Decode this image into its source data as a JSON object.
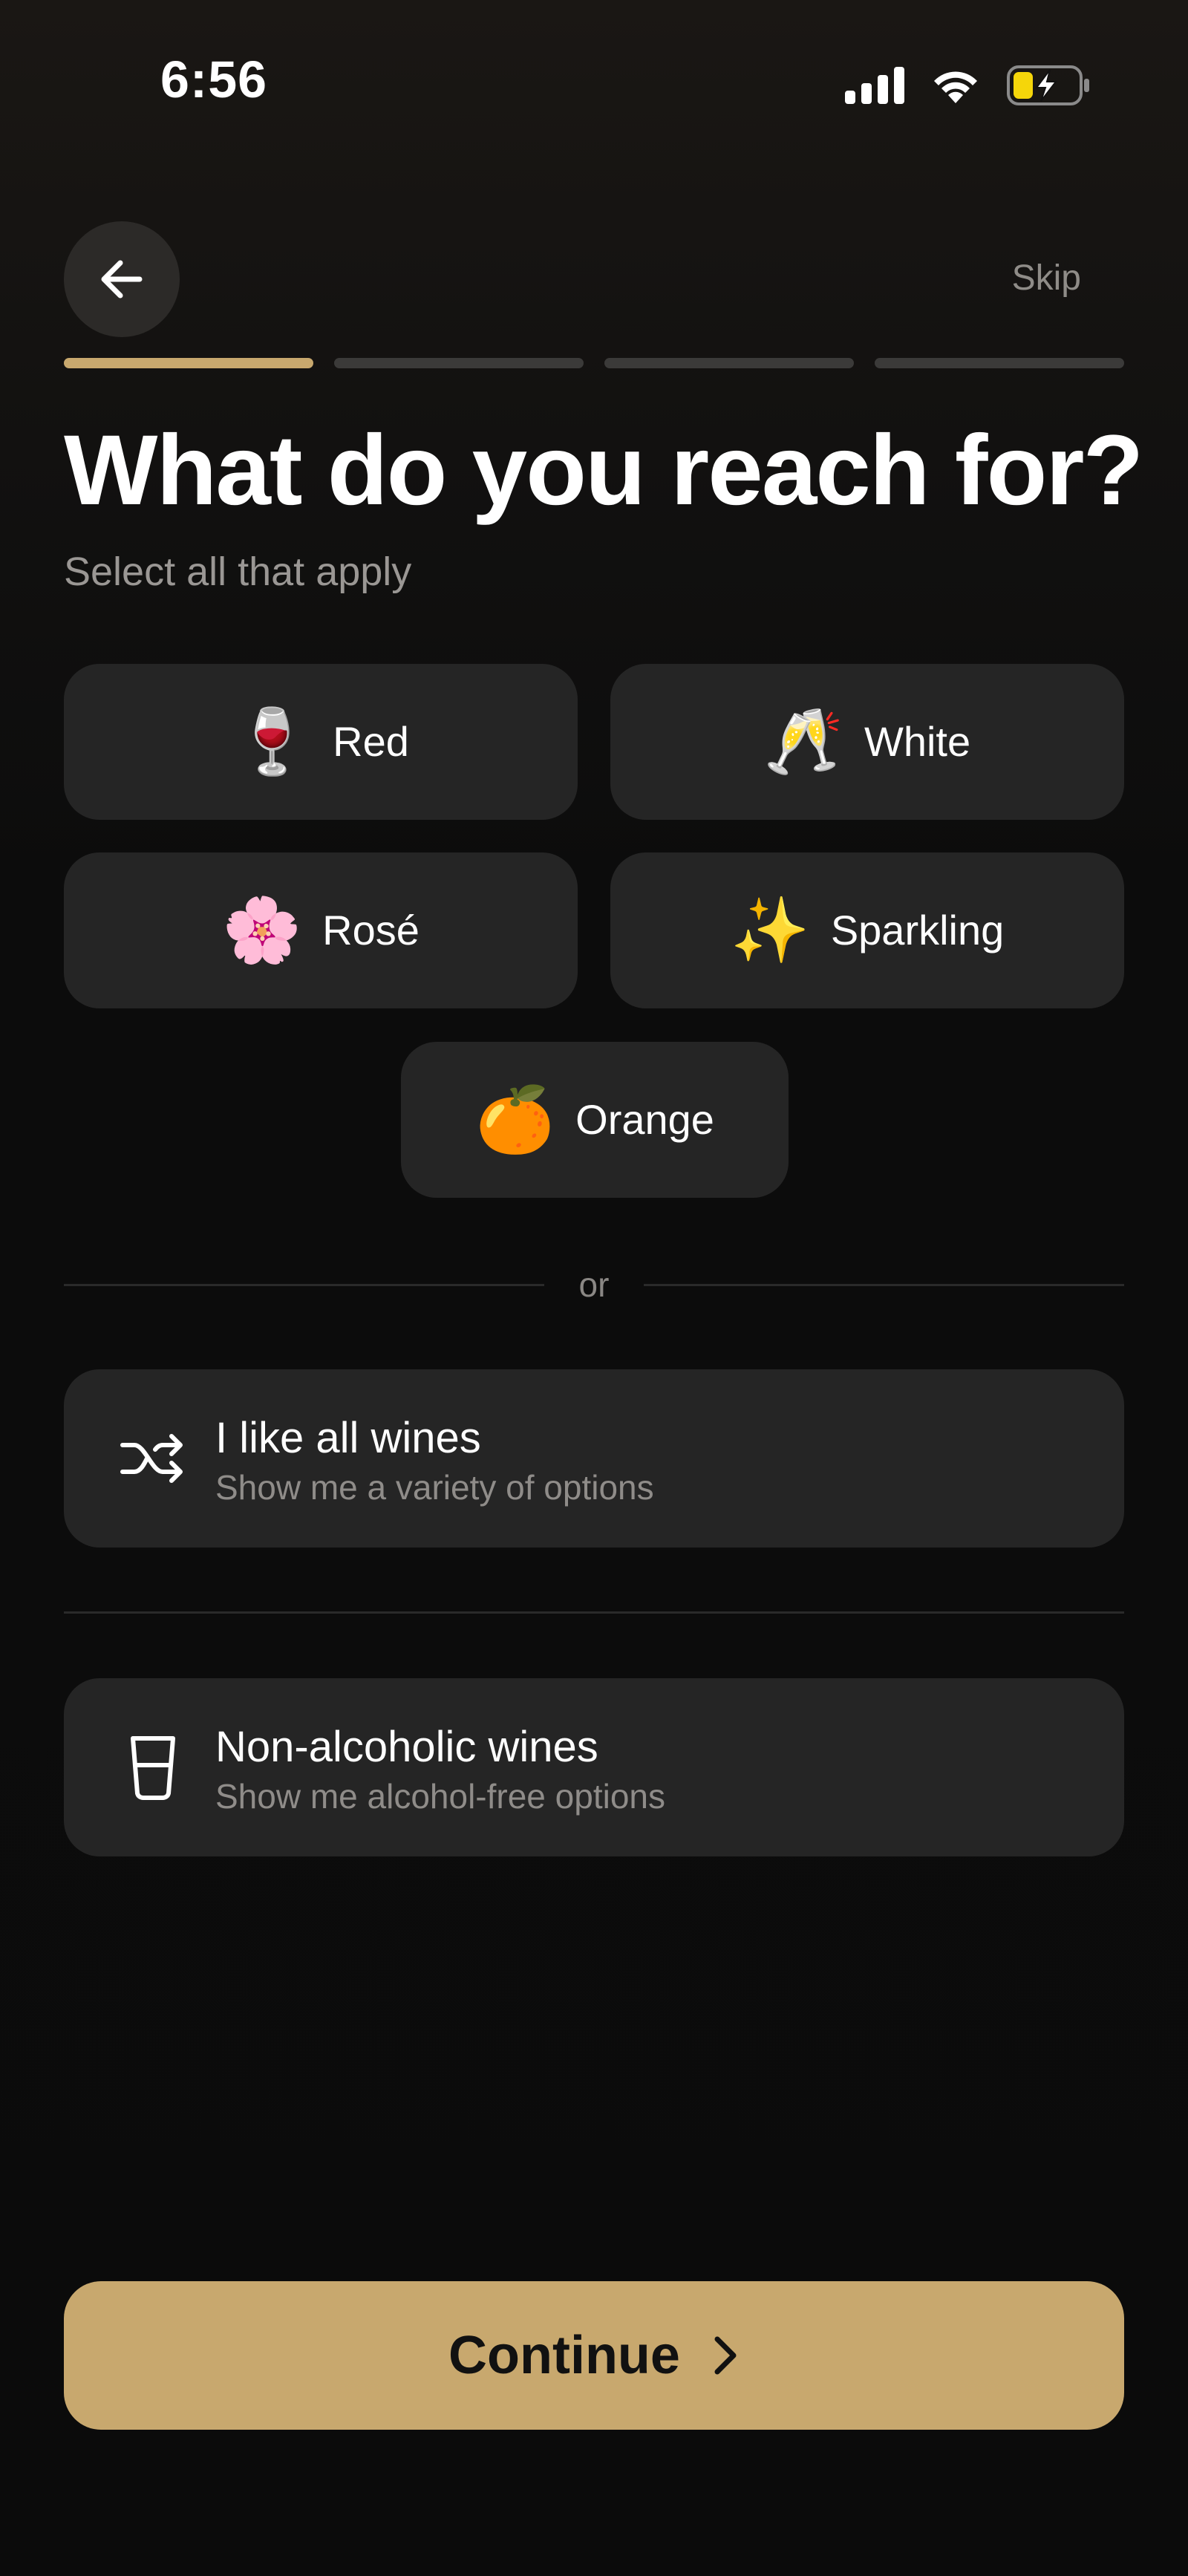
{
  "status_bar": {
    "time": "6:56",
    "signal_icon": "cellular-signal-icon",
    "wifi_icon": "wifi-icon",
    "battery_icon": "battery-charging-icon",
    "battery_color": "#f5d60a"
  },
  "nav": {
    "back_icon": "arrow-left-icon",
    "skip_label": "Skip"
  },
  "progress": {
    "total_steps": 4,
    "current_step": 1,
    "active_color": "#c8a86e"
  },
  "header": {
    "title": "What do you reach for?",
    "subtitle": "Select all that apply"
  },
  "options": [
    {
      "id": "red",
      "emoji": "🍷",
      "label": "Red",
      "icon": "wine-glass-icon"
    },
    {
      "id": "white",
      "emoji": "🥂",
      "label": "White",
      "icon": "champagne-glasses-icon"
    },
    {
      "id": "rose",
      "emoji": "🌸",
      "label": "Rosé",
      "icon": "cherry-blossom-icon"
    },
    {
      "id": "sparkling",
      "emoji": "✨",
      "label": "Sparkling",
      "icon": "sparkles-icon"
    },
    {
      "id": "orange",
      "emoji": "🍊",
      "label": "Orange",
      "icon": "tangerine-icon"
    }
  ],
  "divider": {
    "label": "or"
  },
  "cards": {
    "all_wines": {
      "icon": "shuffle-icon",
      "title": "I like all wines",
      "subtitle": "Show me a variety of options"
    },
    "non_alcoholic": {
      "icon": "water-glass-icon",
      "title": "Non-alcoholic wines",
      "subtitle": "Show me alcohol-free options"
    }
  },
  "footer": {
    "continue_label": "Continue",
    "continue_icon": "chevron-right-icon",
    "accent_color": "#c8a86e"
  }
}
